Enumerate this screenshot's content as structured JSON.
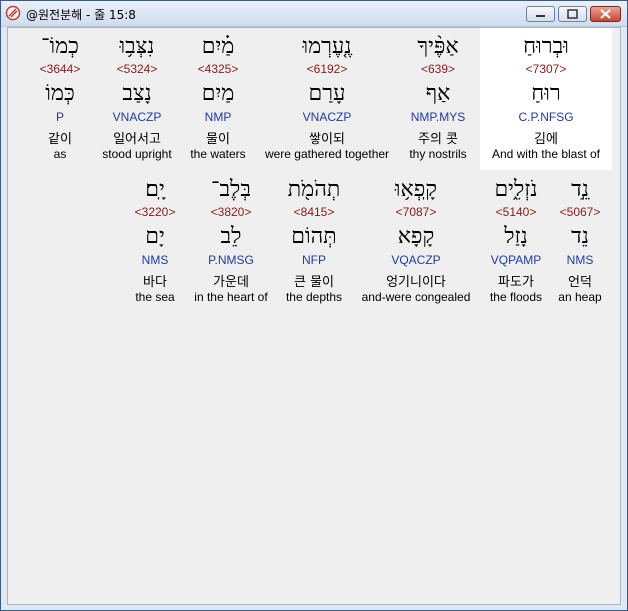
{
  "window": {
    "title": "@원전분해 - 줄 15:8",
    "buttons": {
      "minimize": "minimize",
      "maximize": "maximize",
      "close": "close"
    }
  },
  "rows": [
    {
      "words": [
        {
          "hebrew": "וּבְרוּחַ",
          "strong": "<7307>",
          "root": "רוּחַ",
          "morph": "C.P.NFSG",
          "korean": "김에",
          "english": "And with the blast of",
          "highlight": true
        },
        {
          "hebrew": "אַפֶּ֨יךָ",
          "strong": "<639>",
          "root": "אַף",
          "morph": "NMP.MYS",
          "korean": "주의 콧",
          "english": "thy nostrils",
          "highlight": false
        },
        {
          "hebrew": "נֶ֤עֶרְמוּ",
          "strong": "<6192>",
          "root": "עָרַם",
          "morph": "VNACZP",
          "korean": "쌓이되",
          "english": "were gathered together",
          "highlight": false
        },
        {
          "hebrew": "מַ֗יִם",
          "strong": "<4325>",
          "root": "מַיִם",
          "morph": "NMP",
          "korean": "물이",
          "english": "the waters",
          "highlight": false
        },
        {
          "hebrew": "נִצְּב֥וּ",
          "strong": "<5324>",
          "root": "נָצַב",
          "morph": "VNACZP",
          "korean": "일어서고",
          "english": "stood upright",
          "highlight": false
        },
        {
          "hebrew": "כְמוֹ־",
          "strong": "<3644>",
          "root": "כְּמוֹ",
          "morph": "P",
          "korean": "같이",
          "english": "as",
          "highlight": false
        }
      ]
    },
    {
      "words": [
        {
          "hebrew": "נֵ֣ד",
          "strong": "<5067>",
          "root": "נֵד",
          "morph": "NMS",
          "korean": "언덕",
          "english": "an heap",
          "highlight": false
        },
        {
          "hebrew": "נֹזְלִ֑ים",
          "strong": "<5140>",
          "root": "נָזַל",
          "morph": "VQPAMP",
          "korean": "파도가",
          "english": "the floods",
          "highlight": false
        },
        {
          "hebrew": "קָֽפְא֥וּ",
          "strong": "<7087>",
          "root": "קָפָא",
          "morph": "VQACZP",
          "korean": "엉기니이다",
          "english": "and-were congealed",
          "highlight": false
        },
        {
          "hebrew": "תְהֹמֹ֖ת",
          "strong": "<8415>",
          "root": "תְּהוֹם",
          "morph": "NFP",
          "korean": "큰 물이",
          "english": "the depths",
          "highlight": false
        },
        {
          "hebrew": "בְּלֶב־",
          "strong": "<3820>",
          "root": "לֵב",
          "morph": "P.NMSG",
          "korean": "가운데",
          "english": "in the heart of",
          "highlight": false
        },
        {
          "hebrew": "יָֽם׃",
          "strong": "<3220>",
          "root": "יָם",
          "morph": "NMS",
          "korean": "바다",
          "english": "the sea",
          "highlight": false
        }
      ]
    }
  ]
}
